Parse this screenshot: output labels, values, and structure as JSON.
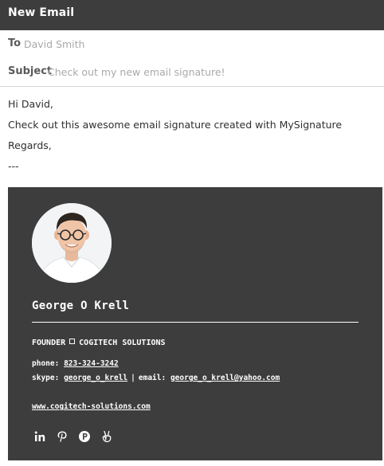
{
  "window": {
    "title": "New Email"
  },
  "to": {
    "label": "To",
    "value": "David Smith"
  },
  "subject": {
    "label": "Subject",
    "value": "Check out my new email signature!"
  },
  "body": {
    "lines": [
      "Hi David,",
      "Check out this awesome email signature created with MySignature",
      "Regards,",
      "---"
    ]
  },
  "signature": {
    "name": "George O Krell",
    "title": "FOUNDER",
    "company": "COGITECH SOLUTIONS",
    "phone_label": "phone:",
    "phone": "823-324-3242",
    "skype_label": "skype:",
    "skype": "george_o_krell",
    "separator": "|",
    "email_label": "email:",
    "email": "george_o_krell@yahoo.com",
    "website": "www.cogitech-solutions.com",
    "social_icons": [
      "linkedin-icon",
      "pinterest-icon",
      "producthunt-icon",
      "angellist-icon"
    ],
    "colors": {
      "background": "#3d3d3d",
      "text": "#ffffff"
    }
  }
}
